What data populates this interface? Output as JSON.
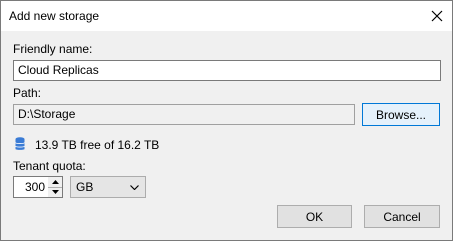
{
  "window": {
    "title": "Add new storage"
  },
  "form": {
    "friendly_name_label": "Friendly name:",
    "friendly_name_value": "Cloud Replicas",
    "path_label": "Path:",
    "path_value": "D:\\Storage",
    "browse_label": "Browse...",
    "capacity_text": "13.9 TB free of 16.2 TB",
    "quota_label": "Tenant quota:",
    "quota_value": "300",
    "quota_unit": "GB"
  },
  "footer": {
    "ok_label": "OK",
    "cancel_label": "Cancel"
  },
  "icons": {
    "storage": "database-icon",
    "close": "close-icon"
  },
  "colors": {
    "storage_icon": "#3a7bd5",
    "focus_border": "#0078d7"
  }
}
